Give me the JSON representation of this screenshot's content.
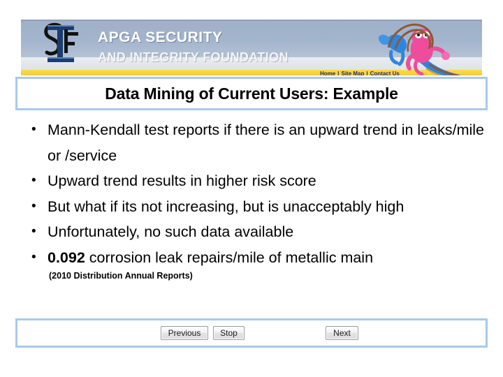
{
  "banner": {
    "logo_alt": "SIF monogram logo",
    "org_line1": "APGA SECURITY",
    "org_line2": "AND INTEGRITY FOUNDATION",
    "nav": [
      {
        "label": "Home"
      },
      {
        "label": "Site Map"
      },
      {
        "label": "Contact Us"
      }
    ],
    "nav_separator": "|",
    "colors": {
      "band_blue": "#a3b4cd",
      "band_gray": "#e4e8ed",
      "band_yellow": "#f8cf3c",
      "nav_text": "#2b2b6e"
    }
  },
  "slide": {
    "title": "Data Mining of Current Users: Example",
    "bullets": [
      {
        "text": "Mann-Kendall test reports if there is an upward trend in leaks/mile or /service"
      },
      {
        "text": "Upward trend results in higher risk score"
      },
      {
        "text": "But what if its not increasing, but is unacceptably high"
      },
      {
        "text": "Unfortunately, no such data available"
      },
      {
        "bold_lead": "0.092",
        "text": " corrosion leak repairs/mile of metallic main",
        "subnote": "(2010 Distribution Annual Reports)"
      }
    ],
    "border_color": "#a9c9e8"
  },
  "controls": {
    "previous_label": "Previous",
    "stop_label": "Stop",
    "next_label": "Next"
  }
}
